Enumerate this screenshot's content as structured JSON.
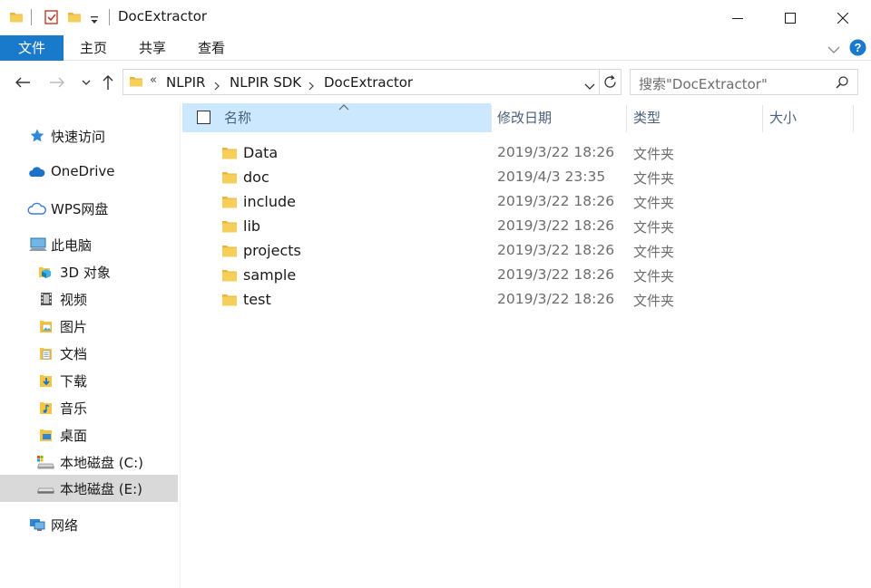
{
  "window": {
    "title": "DocExtractor"
  },
  "ribbon": {
    "tabs": [
      "文件",
      "主页",
      "共享",
      "查看"
    ]
  },
  "address": {
    "overflow": "«",
    "crumbs": [
      "NLPIR",
      "NLPIR SDK",
      "DocExtractor"
    ]
  },
  "search": {
    "placeholder": "搜索\"DocExtractor\""
  },
  "sidebar": {
    "items": [
      {
        "label": "快速访问",
        "icon": "star-icon"
      },
      {
        "label": "OneDrive",
        "icon": "cloud-icon"
      },
      {
        "label": "WPS网盘",
        "icon": "cloud-outline-icon"
      },
      {
        "label": "此电脑",
        "icon": "computer-icon"
      },
      {
        "label": "3D 对象",
        "icon": "3d-objects-icon"
      },
      {
        "label": "视频",
        "icon": "video-icon"
      },
      {
        "label": "图片",
        "icon": "pictures-icon"
      },
      {
        "label": "文档",
        "icon": "documents-icon"
      },
      {
        "label": "下载",
        "icon": "download-icon"
      },
      {
        "label": "音乐",
        "icon": "music-icon"
      },
      {
        "label": "桌面",
        "icon": "desktop-icon"
      },
      {
        "label": "本地磁盘 (C:)",
        "icon": "drive-c-icon"
      },
      {
        "label": "本地磁盘 (E:)",
        "icon": "drive-e-icon",
        "selected": true
      },
      {
        "label": "网络",
        "icon": "network-icon"
      }
    ]
  },
  "columns": {
    "name": "名称",
    "date": "修改日期",
    "type": "类型",
    "size": "大小"
  },
  "files": [
    {
      "name": "Data",
      "date": "2019/3/22 18:26",
      "type": "文件夹"
    },
    {
      "name": "doc",
      "date": "2019/4/3 23:35",
      "type": "文件夹"
    },
    {
      "name": "include",
      "date": "2019/3/22 18:26",
      "type": "文件夹"
    },
    {
      "name": "lib",
      "date": "2019/3/22 18:26",
      "type": "文件夹"
    },
    {
      "name": "projects",
      "date": "2019/3/22 18:26",
      "type": "文件夹"
    },
    {
      "name": "sample",
      "date": "2019/3/22 18:26",
      "type": "文件夹"
    },
    {
      "name": "test",
      "date": "2019/3/22 18:26",
      "type": "文件夹"
    }
  ],
  "colors": {
    "accent": "#1979ca",
    "folder": "#f4c542",
    "header_selected": "#cce8ff",
    "sidebar_selected": "#d9d9d9"
  }
}
